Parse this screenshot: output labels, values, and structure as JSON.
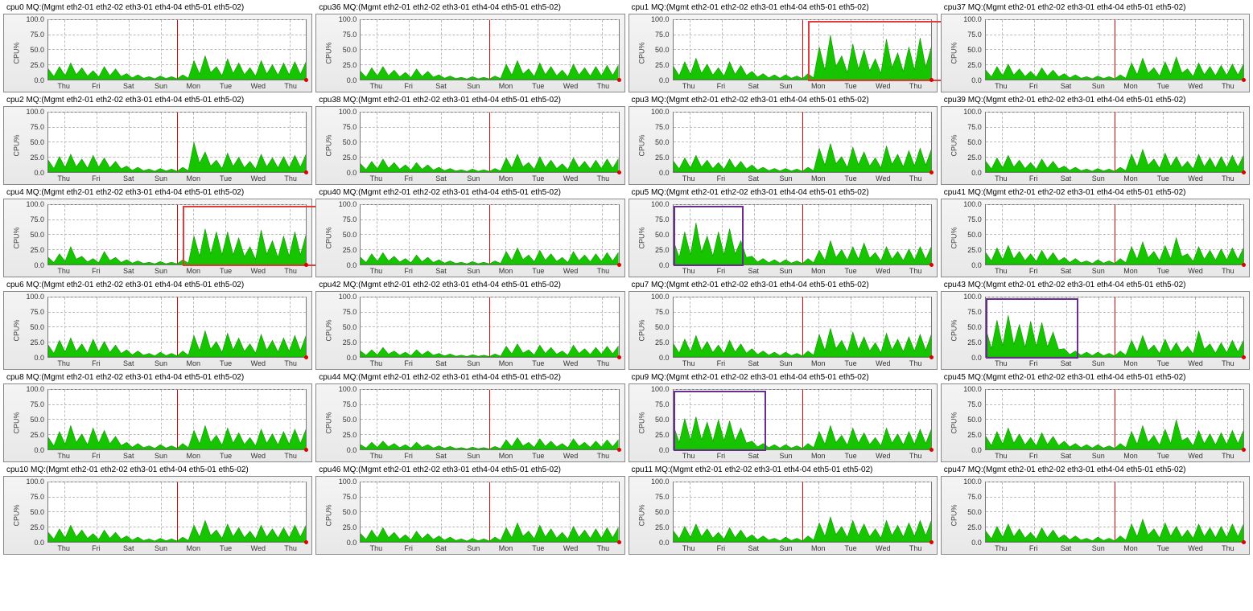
{
  "global": {
    "title_suffix": " MQ:(Mgmt eth2-01 eth2-02 eth3-01 eth4-04 eth5-01 eth5-02)",
    "ylabel": "CPU%",
    "yticks": [
      "0.0",
      "25.0",
      "50.0",
      "75.0",
      "100.0"
    ],
    "xlabels": [
      "Thu",
      "Fri",
      "Sat",
      "Sun",
      "Mon",
      "Tue",
      "Wed",
      "Thu"
    ],
    "redline_after_index": 3,
    "colors": {
      "area": "#17c400",
      "highlight_red": "#e33b3b",
      "highlight_purple": "#6a2c91"
    }
  },
  "chart_data": [
    {
      "cpu": "cpu0",
      "values": [
        18,
        22,
        28,
        20,
        15,
        22,
        18,
        10,
        8,
        5,
        6,
        5,
        8,
        32,
        40,
        22,
        35,
        28,
        20,
        32,
        25,
        28,
        30,
        30
      ],
      "highlight": null
    },
    {
      "cpu": "cpu36",
      "values": [
        14,
        20,
        22,
        16,
        12,
        18,
        14,
        8,
        6,
        4,
        5,
        4,
        6,
        26,
        32,
        18,
        28,
        22,
        16,
        26,
        20,
        22,
        24,
        24
      ],
      "highlight": null
    },
    {
      "cpu": "cpu1",
      "values": [
        22,
        30,
        36,
        26,
        20,
        30,
        24,
        14,
        10,
        8,
        8,
        6,
        10,
        55,
        75,
        40,
        60,
        50,
        35,
        68,
        45,
        55,
        70,
        55
      ],
      "highlight": {
        "color": "red",
        "from": 12,
        "to": 24
      }
    },
    {
      "cpu": "cpu37",
      "values": [
        16,
        22,
        26,
        18,
        14,
        20,
        16,
        10,
        8,
        5,
        6,
        5,
        8,
        28,
        36,
        20,
        30,
        38,
        18,
        28,
        22,
        24,
        26,
        26
      ],
      "highlight": null
    },
    {
      "cpu": "cpu2",
      "values": [
        20,
        26,
        30,
        22,
        28,
        24,
        18,
        10,
        8,
        5,
        6,
        5,
        8,
        50,
        34,
        20,
        32,
        25,
        18,
        30,
        24,
        26,
        28,
        30
      ],
      "highlight": null
    },
    {
      "cpu": "cpu38",
      "values": [
        14,
        18,
        22,
        16,
        12,
        16,
        12,
        8,
        6,
        4,
        5,
        4,
        6,
        24,
        30,
        16,
        26,
        20,
        14,
        24,
        18,
        20,
        22,
        22
      ],
      "highlight": null
    },
    {
      "cpu": "cpu3",
      "values": [
        18,
        24,
        28,
        20,
        16,
        22,
        18,
        12,
        8,
        6,
        6,
        5,
        8,
        40,
        48,
        26,
        42,
        34,
        24,
        44,
        30,
        36,
        40,
        38
      ],
      "highlight": null
    },
    {
      "cpu": "cpu39",
      "values": [
        18,
        24,
        28,
        20,
        16,
        22,
        18,
        10,
        8,
        5,
        6,
        5,
        8,
        30,
        38,
        22,
        32,
        26,
        18,
        30,
        24,
        26,
        28,
        28
      ],
      "highlight": null
    },
    {
      "cpu": "cpu4",
      "values": [
        12,
        18,
        30,
        14,
        10,
        22,
        12,
        8,
        6,
        4,
        5,
        4,
        8,
        48,
        60,
        55,
        55,
        45,
        30,
        58,
        40,
        48,
        55,
        50
      ],
      "highlight": {
        "color": "red",
        "from": 12,
        "to": 24
      }
    },
    {
      "cpu": "cpu40",
      "values": [
        12,
        18,
        20,
        14,
        10,
        16,
        12,
        8,
        6,
        4,
        5,
        4,
        6,
        22,
        28,
        16,
        24,
        18,
        12,
        22,
        16,
        18,
        20,
        20
      ],
      "highlight": null
    },
    {
      "cpu": "cpu5",
      "values": [
        40,
        55,
        70,
        48,
        55,
        60,
        40,
        14,
        10,
        8,
        8,
        6,
        10,
        24,
        40,
        25,
        30,
        36,
        20,
        30,
        22,
        26,
        30,
        30
      ],
      "highlight": {
        "color": "purple",
        "from": 0,
        "to": 6
      }
    },
    {
      "cpu": "cpu41",
      "values": [
        20,
        28,
        32,
        22,
        18,
        24,
        20,
        12,
        10,
        6,
        8,
        6,
        10,
        30,
        38,
        22,
        32,
        45,
        18,
        30,
        24,
        26,
        28,
        28
      ],
      "highlight": null
    },
    {
      "cpu": "cpu6",
      "values": [
        20,
        28,
        32,
        22,
        30,
        26,
        20,
        12,
        10,
        6,
        8,
        6,
        10,
        36,
        44,
        26,
        40,
        32,
        22,
        38,
        28,
        32,
        36,
        36
      ],
      "highlight": null
    },
    {
      "cpu": "cpu42",
      "values": [
        10,
        12,
        16,
        10,
        8,
        12,
        10,
        6,
        5,
        3,
        4,
        3,
        5,
        18,
        22,
        12,
        20,
        16,
        10,
        20,
        14,
        16,
        18,
        18
      ],
      "highlight": null
    },
    {
      "cpu": "cpu7",
      "values": [
        22,
        30,
        36,
        26,
        20,
        28,
        22,
        14,
        10,
        8,
        8,
        6,
        10,
        38,
        48,
        28,
        42,
        34,
        24,
        40,
        30,
        34,
        38,
        38
      ],
      "highlight": null
    },
    {
      "cpu": "cpu43",
      "values": [
        48,
        62,
        70,
        55,
        60,
        58,
        42,
        14,
        10,
        8,
        8,
        6,
        10,
        28,
        36,
        20,
        30,
        24,
        18,
        44,
        22,
        24,
        28,
        28
      ],
      "highlight": {
        "color": "purple",
        "from": 0,
        "to": 8
      }
    },
    {
      "cpu": "cpu8",
      "values": [
        20,
        30,
        40,
        26,
        36,
        32,
        22,
        12,
        10,
        6,
        8,
        6,
        10,
        32,
        40,
        24,
        36,
        28,
        20,
        34,
        26,
        30,
        34,
        34
      ],
      "highlight": null
    },
    {
      "cpu": "cpu44",
      "values": [
        8,
        12,
        14,
        10,
        8,
        12,
        8,
        6,
        5,
        3,
        4,
        3,
        5,
        16,
        20,
        12,
        18,
        14,
        10,
        18,
        12,
        14,
        16,
        16
      ],
      "highlight": null
    },
    {
      "cpu": "cpu9",
      "values": [
        40,
        52,
        55,
        46,
        50,
        48,
        36,
        14,
        10,
        8,
        8,
        6,
        10,
        30,
        40,
        24,
        36,
        28,
        20,
        36,
        26,
        30,
        34,
        34
      ],
      "highlight": {
        "color": "purple",
        "from": 0,
        "to": 8
      }
    },
    {
      "cpu": "cpu45",
      "values": [
        22,
        30,
        36,
        26,
        20,
        28,
        22,
        14,
        10,
        8,
        8,
        6,
        10,
        30,
        40,
        24,
        34,
        50,
        20,
        32,
        26,
        28,
        32,
        32
      ],
      "highlight": null
    },
    {
      "cpu": "cpu10",
      "values": [
        16,
        22,
        28,
        20,
        14,
        20,
        16,
        10,
        8,
        5,
        6,
        5,
        8,
        28,
        36,
        20,
        30,
        24,
        18,
        28,
        22,
        24,
        28,
        28
      ],
      "highlight": null
    },
    {
      "cpu": "cpu46",
      "values": [
        14,
        20,
        24,
        16,
        12,
        18,
        14,
        10,
        8,
        5,
        6,
        5,
        8,
        24,
        32,
        18,
        28,
        22,
        16,
        26,
        20,
        22,
        24,
        24
      ],
      "highlight": null
    },
    {
      "cpu": "cpu11",
      "values": [
        18,
        26,
        30,
        22,
        16,
        24,
        20,
        12,
        10,
        6,
        8,
        6,
        10,
        32,
        42,
        26,
        36,
        30,
        22,
        36,
        28,
        32,
        36,
        36
      ],
      "highlight": null
    },
    {
      "cpu": "cpu47",
      "values": [
        18,
        26,
        30,
        22,
        16,
        24,
        20,
        12,
        10,
        6,
        8,
        6,
        10,
        30,
        38,
        22,
        32,
        26,
        20,
        30,
        24,
        26,
        30,
        30
      ],
      "highlight": null
    }
  ]
}
